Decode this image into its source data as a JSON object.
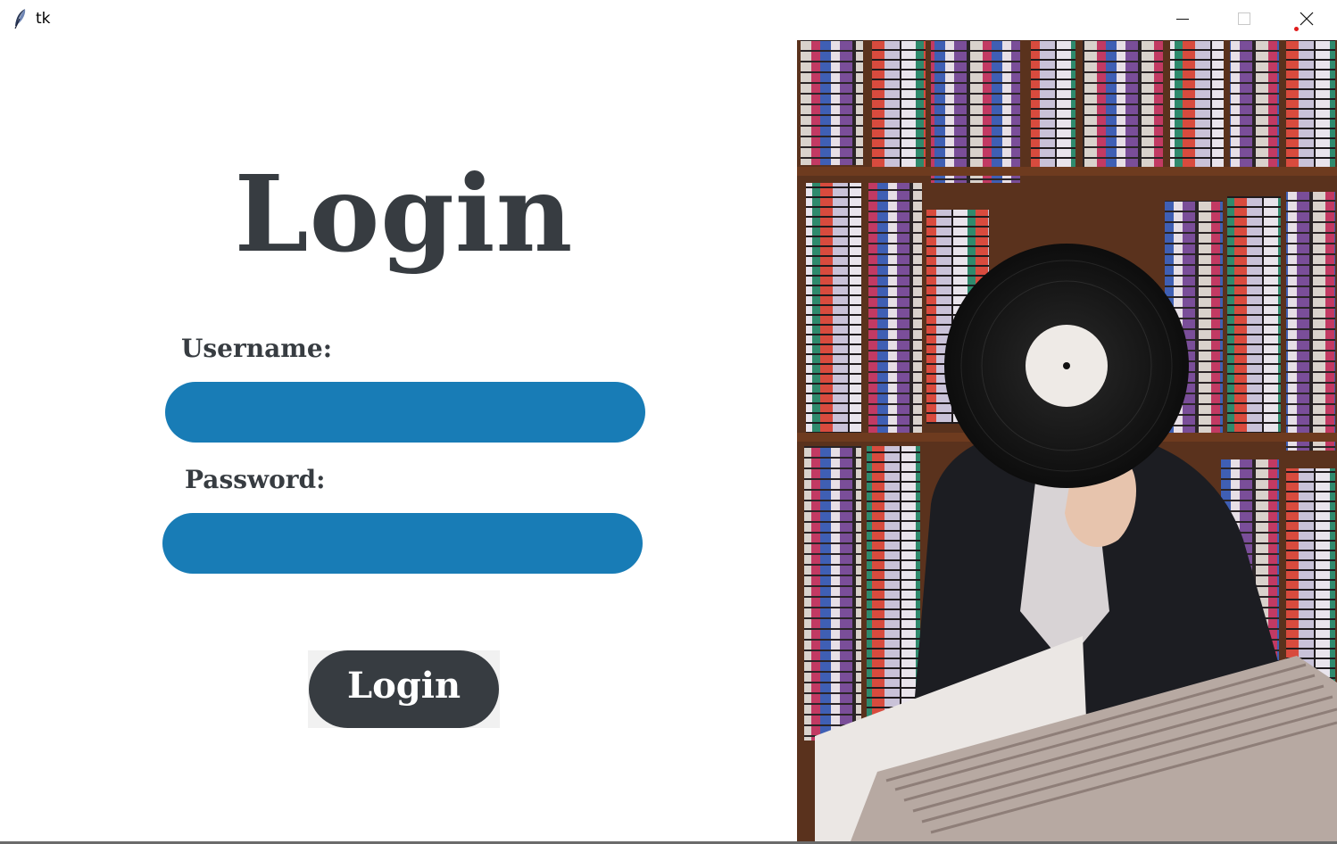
{
  "window": {
    "title": "tk",
    "controls": [
      "minimize",
      "maximize",
      "close"
    ]
  },
  "form": {
    "heading": "Login",
    "username_label": "Username:",
    "username_value": "",
    "password_label": "Password:",
    "password_value": "",
    "submit_label": "Login"
  },
  "colors": {
    "accent_blue": "#187cb6",
    "dark_text": "#373c41",
    "background": "#ffffff"
  },
  "icons": {
    "app": "feather-icon",
    "minimize": "minimize-icon",
    "maximize": "maximize-icon",
    "close": "close-icon"
  },
  "image": {
    "subject": "person holding vinyl record over face in cassette shop"
  }
}
